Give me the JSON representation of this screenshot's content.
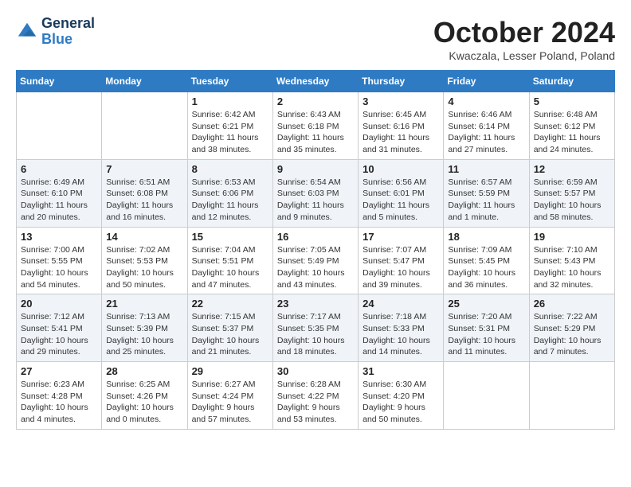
{
  "header": {
    "logo_line1": "General",
    "logo_line2": "Blue",
    "month_title": "October 2024",
    "location": "Kwaczala, Lesser Poland, Poland"
  },
  "days_of_week": [
    "Sunday",
    "Monday",
    "Tuesday",
    "Wednesday",
    "Thursday",
    "Friday",
    "Saturday"
  ],
  "weeks": [
    [
      {
        "day": "",
        "info": ""
      },
      {
        "day": "",
        "info": ""
      },
      {
        "day": "1",
        "info": "Sunrise: 6:42 AM\nSunset: 6:21 PM\nDaylight: 11 hours and 38 minutes."
      },
      {
        "day": "2",
        "info": "Sunrise: 6:43 AM\nSunset: 6:18 PM\nDaylight: 11 hours and 35 minutes."
      },
      {
        "day": "3",
        "info": "Sunrise: 6:45 AM\nSunset: 6:16 PM\nDaylight: 11 hours and 31 minutes."
      },
      {
        "day": "4",
        "info": "Sunrise: 6:46 AM\nSunset: 6:14 PM\nDaylight: 11 hours and 27 minutes."
      },
      {
        "day": "5",
        "info": "Sunrise: 6:48 AM\nSunset: 6:12 PM\nDaylight: 11 hours and 24 minutes."
      }
    ],
    [
      {
        "day": "6",
        "info": "Sunrise: 6:49 AM\nSunset: 6:10 PM\nDaylight: 11 hours and 20 minutes."
      },
      {
        "day": "7",
        "info": "Sunrise: 6:51 AM\nSunset: 6:08 PM\nDaylight: 11 hours and 16 minutes."
      },
      {
        "day": "8",
        "info": "Sunrise: 6:53 AM\nSunset: 6:06 PM\nDaylight: 11 hours and 12 minutes."
      },
      {
        "day": "9",
        "info": "Sunrise: 6:54 AM\nSunset: 6:03 PM\nDaylight: 11 hours and 9 minutes."
      },
      {
        "day": "10",
        "info": "Sunrise: 6:56 AM\nSunset: 6:01 PM\nDaylight: 11 hours and 5 minutes."
      },
      {
        "day": "11",
        "info": "Sunrise: 6:57 AM\nSunset: 5:59 PM\nDaylight: 11 hours and 1 minute."
      },
      {
        "day": "12",
        "info": "Sunrise: 6:59 AM\nSunset: 5:57 PM\nDaylight: 10 hours and 58 minutes."
      }
    ],
    [
      {
        "day": "13",
        "info": "Sunrise: 7:00 AM\nSunset: 5:55 PM\nDaylight: 10 hours and 54 minutes."
      },
      {
        "day": "14",
        "info": "Sunrise: 7:02 AM\nSunset: 5:53 PM\nDaylight: 10 hours and 50 minutes."
      },
      {
        "day": "15",
        "info": "Sunrise: 7:04 AM\nSunset: 5:51 PM\nDaylight: 10 hours and 47 minutes."
      },
      {
        "day": "16",
        "info": "Sunrise: 7:05 AM\nSunset: 5:49 PM\nDaylight: 10 hours and 43 minutes."
      },
      {
        "day": "17",
        "info": "Sunrise: 7:07 AM\nSunset: 5:47 PM\nDaylight: 10 hours and 39 minutes."
      },
      {
        "day": "18",
        "info": "Sunrise: 7:09 AM\nSunset: 5:45 PM\nDaylight: 10 hours and 36 minutes."
      },
      {
        "day": "19",
        "info": "Sunrise: 7:10 AM\nSunset: 5:43 PM\nDaylight: 10 hours and 32 minutes."
      }
    ],
    [
      {
        "day": "20",
        "info": "Sunrise: 7:12 AM\nSunset: 5:41 PM\nDaylight: 10 hours and 29 minutes."
      },
      {
        "day": "21",
        "info": "Sunrise: 7:13 AM\nSunset: 5:39 PM\nDaylight: 10 hours and 25 minutes."
      },
      {
        "day": "22",
        "info": "Sunrise: 7:15 AM\nSunset: 5:37 PM\nDaylight: 10 hours and 21 minutes."
      },
      {
        "day": "23",
        "info": "Sunrise: 7:17 AM\nSunset: 5:35 PM\nDaylight: 10 hours and 18 minutes."
      },
      {
        "day": "24",
        "info": "Sunrise: 7:18 AM\nSunset: 5:33 PM\nDaylight: 10 hours and 14 minutes."
      },
      {
        "day": "25",
        "info": "Sunrise: 7:20 AM\nSunset: 5:31 PM\nDaylight: 10 hours and 11 minutes."
      },
      {
        "day": "26",
        "info": "Sunrise: 7:22 AM\nSunset: 5:29 PM\nDaylight: 10 hours and 7 minutes."
      }
    ],
    [
      {
        "day": "27",
        "info": "Sunrise: 6:23 AM\nSunset: 4:28 PM\nDaylight: 10 hours and 4 minutes."
      },
      {
        "day": "28",
        "info": "Sunrise: 6:25 AM\nSunset: 4:26 PM\nDaylight: 10 hours and 0 minutes."
      },
      {
        "day": "29",
        "info": "Sunrise: 6:27 AM\nSunset: 4:24 PM\nDaylight: 9 hours and 57 minutes."
      },
      {
        "day": "30",
        "info": "Sunrise: 6:28 AM\nSunset: 4:22 PM\nDaylight: 9 hours and 53 minutes."
      },
      {
        "day": "31",
        "info": "Sunrise: 6:30 AM\nSunset: 4:20 PM\nDaylight: 9 hours and 50 minutes."
      },
      {
        "day": "",
        "info": ""
      },
      {
        "day": "",
        "info": ""
      }
    ]
  ]
}
